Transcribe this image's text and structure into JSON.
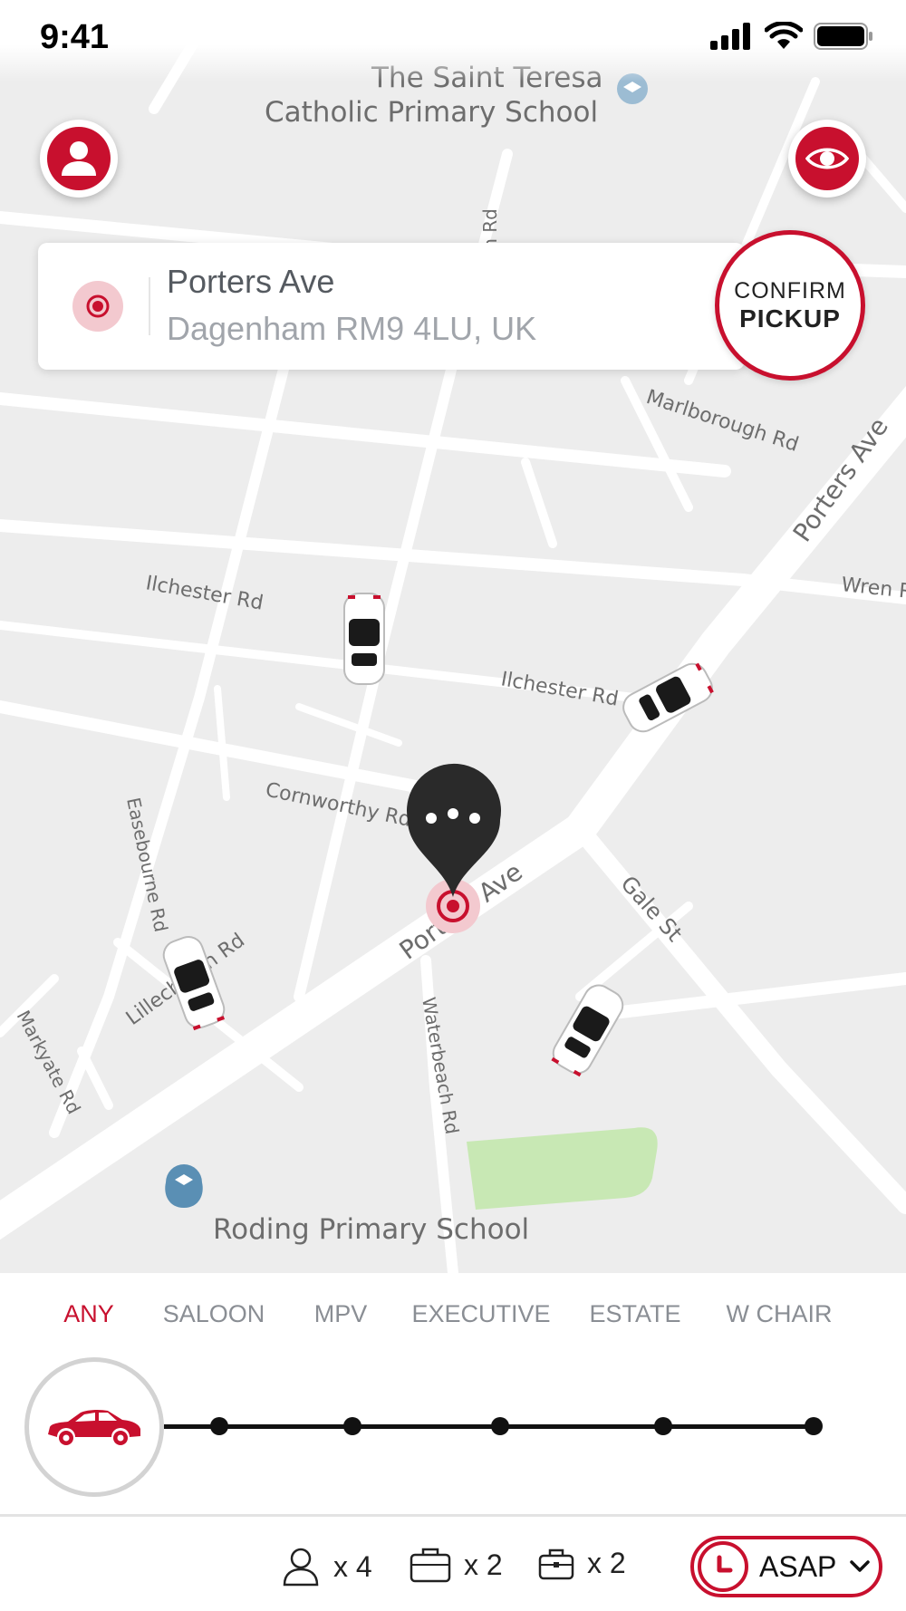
{
  "status_bar": {
    "time": "9:41"
  },
  "map": {
    "labels": {
      "school_top_line1": "The Saint Teresa",
      "school_top_line2": "Catholic Primary School",
      "marlborough": "Marlborough Rd",
      "porters_ave_ne": "Porters Ave",
      "wren": "Wren R",
      "ilchester_1": "Ilchester Rd",
      "ilchester_2": "Ilchester Rd",
      "cornworthy": "Cornworthy Rd",
      "easebourne": "Easebourne Rd",
      "lillechurch": "Lillechurch Rd",
      "porters_ave_center": "Porters Ave",
      "gale": "Gale St",
      "markyate": "Markyate Rd",
      "waterbeach": "Waterbeach Rd",
      "school_bottom": "Roding Primary School",
      "road_vertical": "on Rd"
    }
  },
  "address": {
    "street": "Porters Ave",
    "city": "Dagenham RM9 4LU, UK"
  },
  "confirm": {
    "line1": "CONFIRM",
    "line2": "PICKUP"
  },
  "vehicle_tabs": [
    {
      "label": "ANY",
      "active": true
    },
    {
      "label": "SALOON",
      "active": false
    },
    {
      "label": "MPV",
      "active": false
    },
    {
      "label": "EXECUTIVE",
      "active": false
    },
    {
      "label": "ESTATE",
      "active": false
    },
    {
      "label": "W CHAIR",
      "active": false
    }
  ],
  "capacity": {
    "passengers": "x 4",
    "large_bags": "x 2",
    "small_bags": "x 2"
  },
  "time_select": {
    "value": "ASAP"
  },
  "icons": {
    "profile": "user-icon",
    "visibility": "eye-icon",
    "pickup_pin": "target-pin-icon",
    "car": "car-icon",
    "clock": "clock-icon"
  },
  "colors": {
    "accent": "#c8102e",
    "map_bg": "#ededed",
    "park": "#c8e8b4"
  }
}
